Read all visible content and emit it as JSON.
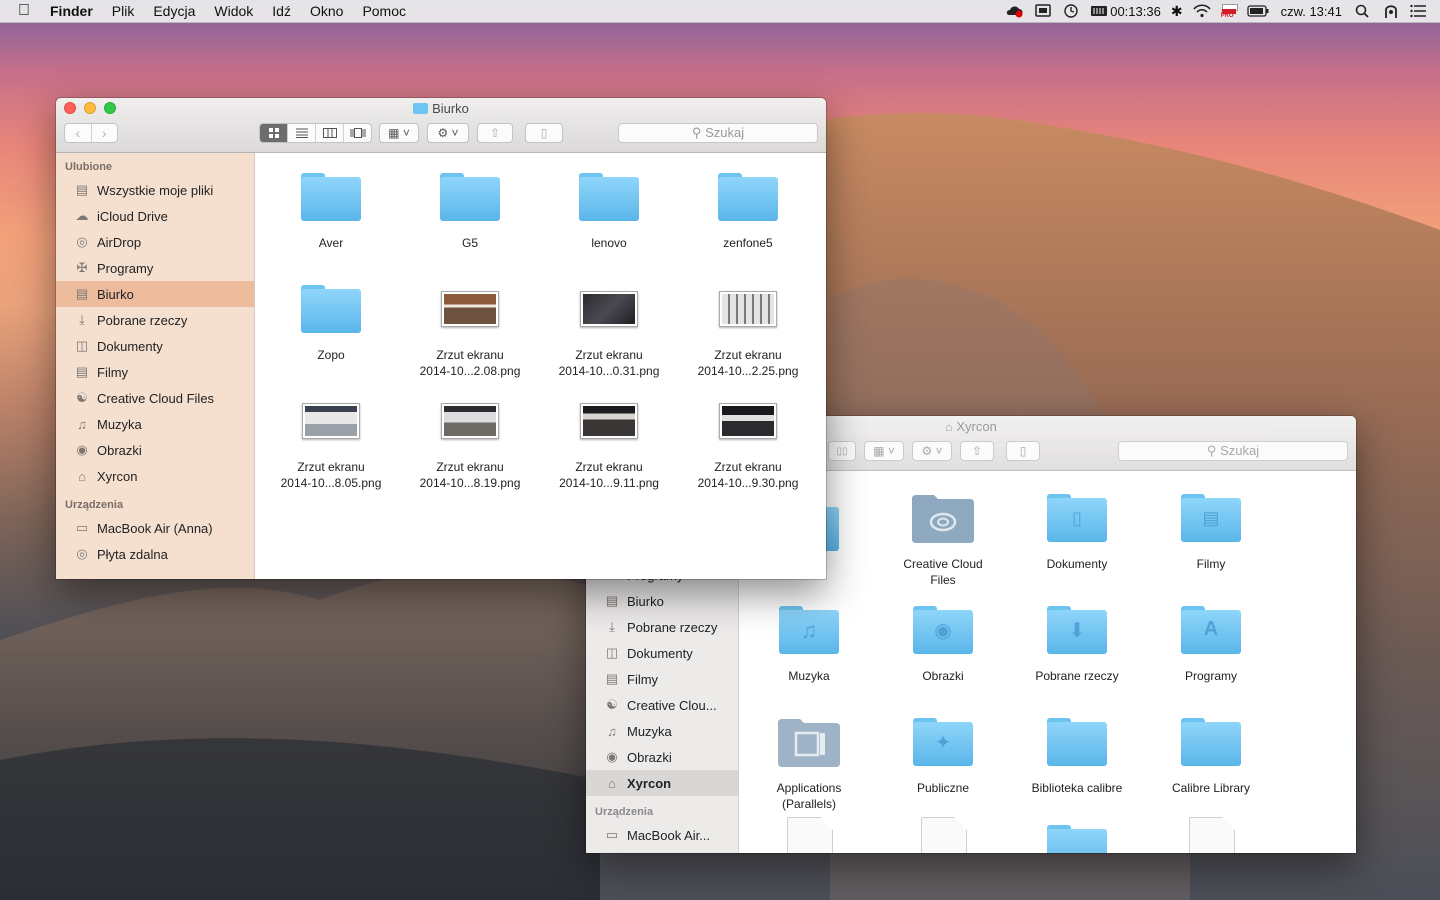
{
  "menubar": {
    "app": "Finder",
    "items": [
      "Plik",
      "Edycja",
      "Widok",
      "Idź",
      "Okno",
      "Pomoc"
    ],
    "timer": "00:13:36",
    "clock": "czw. 13:41",
    "flag_text": "PRO"
  },
  "front_window": {
    "title": "Biurko",
    "search_placeholder": "Szukaj",
    "sidebar": {
      "favorites_header": "Ulubione",
      "favorites": [
        {
          "label": "Wszystkie moje pliki",
          "icon": "all-files-icon"
        },
        {
          "label": "iCloud Drive",
          "icon": "cloud-icon"
        },
        {
          "label": "AirDrop",
          "icon": "airdrop-icon"
        },
        {
          "label": "Programy",
          "icon": "apps-icon"
        },
        {
          "label": "Biurko",
          "icon": "desktop-icon"
        },
        {
          "label": "Pobrane rzeczy",
          "icon": "download-icon"
        },
        {
          "label": "Dokumenty",
          "icon": "document-icon"
        },
        {
          "label": "Filmy",
          "icon": "film-icon"
        },
        {
          "label": "Creative Cloud Files",
          "icon": "creative-cloud-icon"
        },
        {
          "label": "Muzyka",
          "icon": "music-icon"
        },
        {
          "label": "Obrazki",
          "icon": "camera-icon"
        },
        {
          "label": "Xyrcon",
          "icon": "home-icon"
        }
      ],
      "devices_header": "Urządzenia",
      "devices": [
        {
          "label": "MacBook Air (Anna)",
          "icon": "laptop-icon"
        },
        {
          "label": "Płyta zdalna",
          "icon": "disc-icon"
        }
      ]
    },
    "items": [
      {
        "l1": "Aver",
        "l2": "",
        "kind": "folder"
      },
      {
        "l1": "G5",
        "l2": "",
        "kind": "folder"
      },
      {
        "l1": "lenovo",
        "l2": "",
        "kind": "folder"
      },
      {
        "l1": "zenfone5",
        "l2": "",
        "kind": "folder"
      },
      {
        "l1": "Zopo",
        "l2": "",
        "kind": "folder"
      },
      {
        "l1": "Zrzut ekranu",
        "l2": "2014-10...2.08.png",
        "kind": "thumb",
        "color": "#7a5a3a"
      },
      {
        "l1": "Zrzut ekranu",
        "l2": "2014-10...0.31.png",
        "kind": "thumb",
        "color": "#2a2a2e"
      },
      {
        "l1": "Zrzut ekranu",
        "l2": "2014-10...2.25.png",
        "kind": "thumb",
        "color": "#d8d8d8"
      },
      {
        "l1": "Zrzut ekranu",
        "l2": "2014-10...8.05.png",
        "kind": "thumb",
        "color": "#9aa0a8"
      },
      {
        "l1": "Zrzut ekranu",
        "l2": "2014-10...8.19.png",
        "kind": "thumb",
        "color": "#6e6a66"
      },
      {
        "l1": "Zrzut ekranu",
        "l2": "2014-10...9.11.png",
        "kind": "thumb",
        "color": "#3a3636"
      },
      {
        "l1": "Zrzut ekranu",
        "l2": "2014-10...9.30.png",
        "kind": "thumb",
        "color": "#2c2c30"
      }
    ]
  },
  "back_window": {
    "title": "Xyrcon",
    "search_placeholder": "Szukaj",
    "sidebar": {
      "favorites": [
        {
          "label": "Programy",
          "icon": "apps-icon"
        },
        {
          "label": "Biurko",
          "icon": "desktop-icon"
        },
        {
          "label": "Pobrane rzeczy",
          "icon": "download-icon"
        },
        {
          "label": "Dokumenty",
          "icon": "document-icon"
        },
        {
          "label": "Filmy",
          "icon": "film-icon"
        },
        {
          "label": "Creative Clou...",
          "icon": "creative-cloud-icon"
        },
        {
          "label": "Muzyka",
          "icon": "music-icon"
        },
        {
          "label": "Obrazki",
          "icon": "camera-icon"
        },
        {
          "label": "Xyrcon",
          "icon": "home-icon"
        }
      ],
      "devices_header": "Urządzenia",
      "devices": [
        {
          "label": "MacBook Air...",
          "icon": "laptop-icon"
        }
      ]
    },
    "items": [
      {
        "l1": "Creative Cloud",
        "l2": "Files",
        "kind": "cc-folder"
      },
      {
        "l1": "Dokumenty",
        "l2": "",
        "kind": "folder",
        "glyph": "▯"
      },
      {
        "l1": "Filmy",
        "l2": "",
        "kind": "folder",
        "glyph": "▤"
      },
      {
        "l1": "Muzyka",
        "l2": "",
        "kind": "folder",
        "glyph": "♫"
      },
      {
        "l1": "Obrazki",
        "l2": "",
        "kind": "folder",
        "glyph": "◉"
      },
      {
        "l1": "Pobrane rzeczy",
        "l2": "",
        "kind": "folder",
        "glyph": "⬇"
      },
      {
        "l1": "Programy",
        "l2": "",
        "kind": "folder",
        "glyph": "A"
      },
      {
        "l1": "Applications",
        "l2": "(Parallels)",
        "kind": "gray-folder"
      },
      {
        "l1": "Publiczne",
        "l2": "",
        "kind": "folder",
        "glyph": "✦"
      },
      {
        "l1": "Biblioteka calibre",
        "l2": "",
        "kind": "folder"
      },
      {
        "l1": "Calibre Library",
        "l2": "",
        "kind": "folder"
      }
    ]
  },
  "colors": {
    "folder": "#6ec4f0",
    "sidebar": "#f4dece",
    "selection": "#e8b08c"
  }
}
